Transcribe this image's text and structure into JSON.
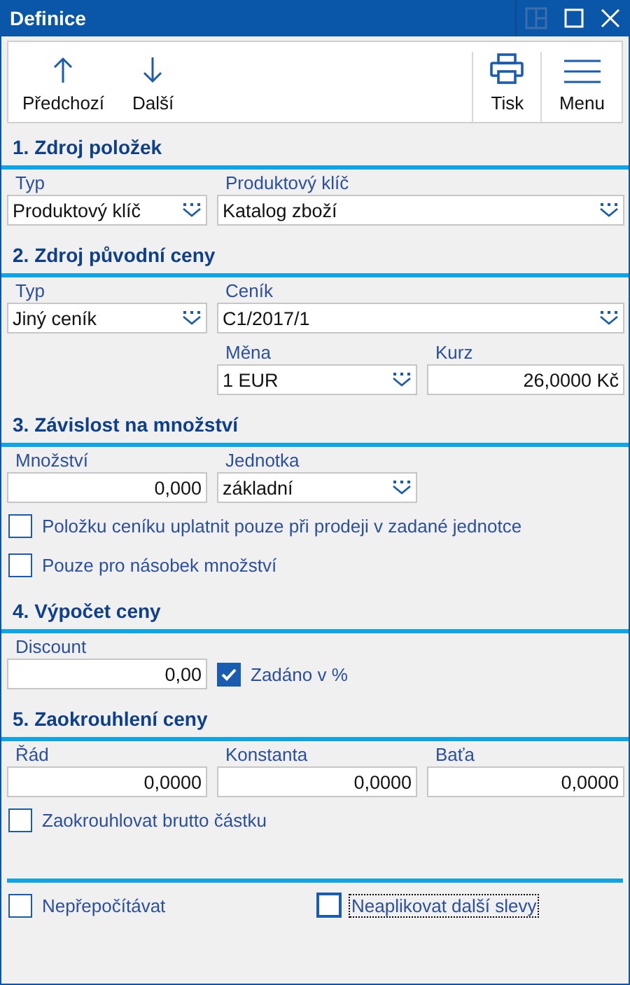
{
  "window": {
    "title": "Definice"
  },
  "toolbar": {
    "left": [
      {
        "label": "Předchozí"
      },
      {
        "label": "Další"
      }
    ],
    "right": [
      {
        "label": "Tisk"
      },
      {
        "label": "Menu"
      }
    ]
  },
  "sections": [
    {
      "title": "1. Zdroj položek",
      "rows": [
        [
          {
            "kind": "select",
            "label": "Typ",
            "value": "Produktový klíč"
          },
          {
            "kind": "select",
            "label": "Produktový klíč",
            "value": "Katalog zboží"
          }
        ]
      ]
    },
    {
      "title": "2. Zdroj původní ceny",
      "rows": [
        [
          {
            "kind": "select",
            "label": "Typ",
            "value": "Jiný ceník"
          },
          {
            "kind": "select",
            "label": "Ceník",
            "value": "C1/2017/1"
          }
        ],
        [
          "",
          {
            "kind": "select",
            "label": "Měna",
            "value": "1 EUR"
          },
          {
            "kind": "number",
            "label": "Kurz",
            "value": "26,0000 Kč"
          }
        ]
      ]
    },
    {
      "title": "3. Závislost na množství",
      "rows": [
        [
          {
            "kind": "number",
            "label": "Množství",
            "value": "0,000"
          },
          {
            "kind": "select",
            "label": "Jednotka",
            "value": "základní"
          }
        ],
        [
          {
            "kind": "checkbox",
            "label": "Položku ceníku uplatnit pouze při prodeji v zadané jednotce",
            "checked": false,
            "focused": false
          }
        ],
        [
          {
            "kind": "checkbox",
            "label": "Pouze pro násobek množství",
            "checked": false,
            "focused": false
          }
        ]
      ]
    },
    {
      "title": "4. Výpočet ceny",
      "rows": [
        [
          {
            "kind": "number",
            "label": "Discount",
            "value": "0,00",
            "option": {
              "label": "Zadáno v %",
              "checked": true,
              "focused": false
            }
          }
        ]
      ]
    },
    {
      "title": "5. Zaokrouhlení ceny",
      "rows": [
        [
          {
            "kind": "number",
            "label": "Řád",
            "value": "0,0000"
          },
          {
            "kind": "number",
            "label": "Konstanta",
            "value": "0,0000"
          },
          {
            "kind": "number",
            "label": "Baťa",
            "value": "0,0000"
          }
        ],
        [
          {
            "kind": "checkbox",
            "label": "Zaokrouhlovat brutto částku",
            "checked": false,
            "focused": false
          }
        ]
      ]
    }
  ],
  "footer": [
    {
      "label": "Nepřepočítávat",
      "checked": false,
      "focused": false
    },
    {
      "label": "Neaplikovat další slevy",
      "checked": false,
      "focused": true
    }
  ]
}
